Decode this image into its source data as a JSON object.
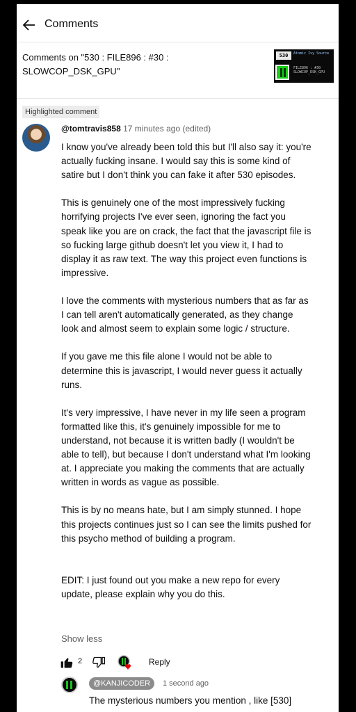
{
  "header": {
    "title": "Comments"
  },
  "video": {
    "caption": "Comments on \"530 : FILE896 : #30 : SLOWCOP_DSK_GPU\"",
    "thumb_badge": "530",
    "thumb_channel": "Atomic Ivy Source",
    "thumb_meta_1": "FILE896 : #30",
    "thumb_meta_2": "SLOWCOP_DSK_GPU"
  },
  "highlighted_label": "Highlighted comment",
  "comment": {
    "author": "@tomtravis858",
    "time": "17 minutes ago (edited)",
    "paragraphs": [
      "I know you've already been told this but I'll also say it: you're actually fucking insane. I would say this is some kind of satire but I don't think you can fake it after 530 episodes.",
      "This is genuinely one of the most impressively fucking horrifying projects I've ever seen, ignoring the fact you speak like you are on crack, the fact that the javascript file is so fucking large github doesn't let you view it, I had to display it as raw text. The way this project even functions is impressive.",
      "I love the comments with mysterious numbers that as far as I can tell aren't automatically generated, as they change look and almost seem to explain some logic / structure.",
      "If you gave me this file alone I would not be able to determine this is javascript, I would never guess it actually runs.",
      "It's very impressive, I have never in my life seen a program formatted like this, it's genuinely impossible for me to understand, not because it is written badly (I wouldn't be able to tell), but because I don't understand what I'm looking at. I appreciate you making the comments that are actually written in words as vague as possible.",
      "This is by no means hate, but I am simply stunned. I hope this projects continues just so I can see the limits pushed for this psycho method of building a program.",
      "EDIT: I just found out you make a new repo for every update, please explain why you do this."
    ],
    "show_less": "Show less",
    "like_count": "2",
    "reply_label": "Reply"
  },
  "reply": {
    "author": "@KANJICODER",
    "time": "1 second ago",
    "text": "The mysterious numbers you mention , like [530]"
  },
  "colors": {
    "background": "#000000",
    "surface": "#ffffff",
    "muted": "#606060",
    "heart": "#e00000",
    "logo_green": "#16d116"
  },
  "icons": [
    "back-arrow-icon",
    "thumbs-up-icon",
    "thumbs-down-icon",
    "creator-heart-icon"
  ]
}
